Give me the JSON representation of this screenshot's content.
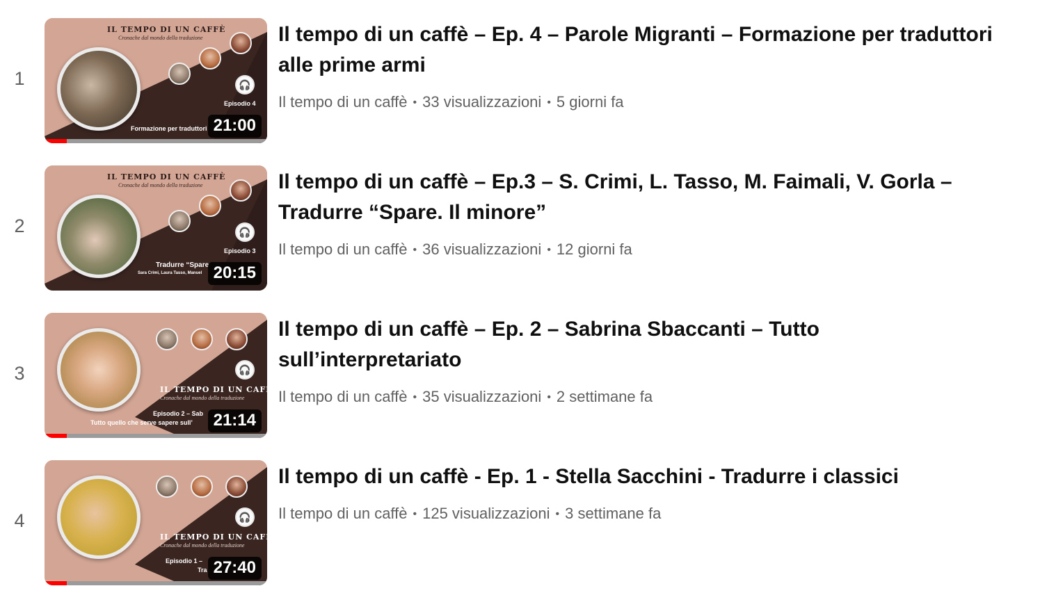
{
  "videos": [
    {
      "index": "1",
      "title": "Il tempo di un caffè – Ep. 4 – Parole Migranti – Formazione per traduttori alle prime armi",
      "channel": "Il tempo di un caffè",
      "views": "33 visualizzazioni",
      "age": "5 giorni fa",
      "duration": "21:00",
      "watched_fraction": 0.1,
      "thumb": {
        "brand": "IL TEMPO DI UN CAFFÈ",
        "brand_sub": "Cronache dal mondo della traduzione",
        "episode": "Episodio 4",
        "caption": "Formazione per traduttori"
      }
    },
    {
      "index": "2",
      "title": "Il tempo di un caffè – Ep.3 – S. Crimi, L. Tasso, M. Faimali, V. Gorla – Tradurre “Spare. Il minore”",
      "channel": "Il tempo di un caffè",
      "views": "36 visualizzazioni",
      "age": "12 giorni fa",
      "duration": "20:15",
      "watched_fraction": 0,
      "thumb": {
        "brand": "IL TEMPO DI UN CAFFÈ",
        "brand_sub": "Cronache dal mondo della traduzione",
        "episode": "Episodio 3",
        "caption": "Tradurre “Spare",
        "caption2": "Sara Crimi, Laura Tasso, Manuel"
      }
    },
    {
      "index": "3",
      "title": "Il tempo di un caffè – Ep. 2 – Sabrina Sbaccanti – Tutto sull’interpretariato",
      "channel": "Il tempo di un caffè",
      "views": "35 visualizzazioni",
      "age": "2 settimane fa",
      "duration": "21:14",
      "watched_fraction": 0.1,
      "thumb": {
        "brand": "IL TEMPO DI UN CAFFÈ",
        "brand_sub": "Cronache dal mondo della traduzione",
        "episode": "Episodio 2 – Sab",
        "caption": "Tutto quello che serve sapere sull’"
      }
    },
    {
      "index": "4",
      "title": "Il tempo di un caffè - Ep. 1 - Stella Sacchini - Tradurre i classici",
      "channel": "Il tempo di un caffè",
      "views": "125 visualizzazioni",
      "age": "3 settimane fa",
      "duration": "27:40",
      "watched_fraction": 0.1,
      "thumb": {
        "brand": "IL TEMPO DI UN CAFFÈ",
        "brand_sub": "Cronache dal mondo della traduzione",
        "episode": "Episodio 1 –",
        "caption": "Tra"
      }
    }
  ],
  "colors": {
    "thumb_pink": "#d3a594",
    "thumb_brown": "#3a2521",
    "progress_red": "#ff0000",
    "meta_gray": "#606060",
    "title_black": "#0f0f0f"
  },
  "icons": {
    "separator": "•",
    "podcast_badge": "🎧"
  }
}
